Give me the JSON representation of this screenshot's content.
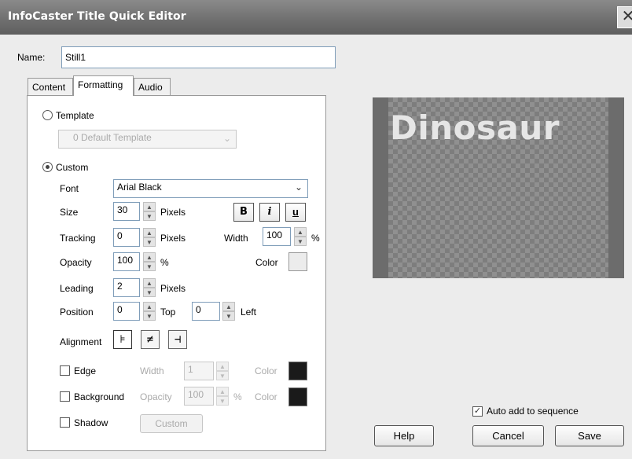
{
  "window": {
    "title": "InfoCaster Title Quick Editor",
    "close_glyph": "✕"
  },
  "name_field": {
    "label": "Name:",
    "value": "Still1"
  },
  "tabs": [
    {
      "label": "Content",
      "active": false
    },
    {
      "label": "Formatting",
      "active": true
    },
    {
      "label": "Audio",
      "active": false
    }
  ],
  "template": {
    "label": "Template",
    "select_value": "0 Default Template",
    "selected": false
  },
  "custom": {
    "label": "Custom",
    "selected": true,
    "font": {
      "label": "Font",
      "value": "Arial Black"
    },
    "size": {
      "label": "Size",
      "value": "30",
      "unit": "Pixels"
    },
    "style_buttons": {
      "bold": "B",
      "italic": "i",
      "underline": "u"
    },
    "tracking": {
      "label": "Tracking",
      "value": "0",
      "unit": "Pixels"
    },
    "width": {
      "label": "Width",
      "value": "100",
      "unit": "%"
    },
    "opacity": {
      "label": "Opacity",
      "value": "100",
      "unit": "%"
    },
    "color": {
      "label": "Color",
      "value": "#ececec"
    },
    "leading": {
      "label": "Leading",
      "value": "2",
      "unit": "Pixels"
    },
    "position": {
      "label": "Position",
      "top_value": "0",
      "top_label": "Top",
      "left_value": "0",
      "left_label": "Left"
    },
    "alignment": {
      "label": "Alignment",
      "options": [
        "left",
        "center",
        "right"
      ],
      "selected": "left"
    }
  },
  "effects": {
    "edge": {
      "label": "Edge",
      "checked": false,
      "width_label": "Width",
      "width_value": "1",
      "color_label": "Color",
      "color": "#1a1a1a"
    },
    "background": {
      "label": "Background",
      "checked": false,
      "opacity_label": "Opacity",
      "opacity_value": "100",
      "unit": "%",
      "color_label": "Color",
      "color": "#1a1a1a"
    },
    "shadow": {
      "label": "Shadow",
      "checked": false,
      "button_label": "Custom"
    }
  },
  "preview": {
    "text": "Dinosaur"
  },
  "auto_add": {
    "label": "Auto add to sequence",
    "checked": true
  },
  "buttons": {
    "help": "Help",
    "cancel": "Cancel",
    "save": "Save"
  }
}
